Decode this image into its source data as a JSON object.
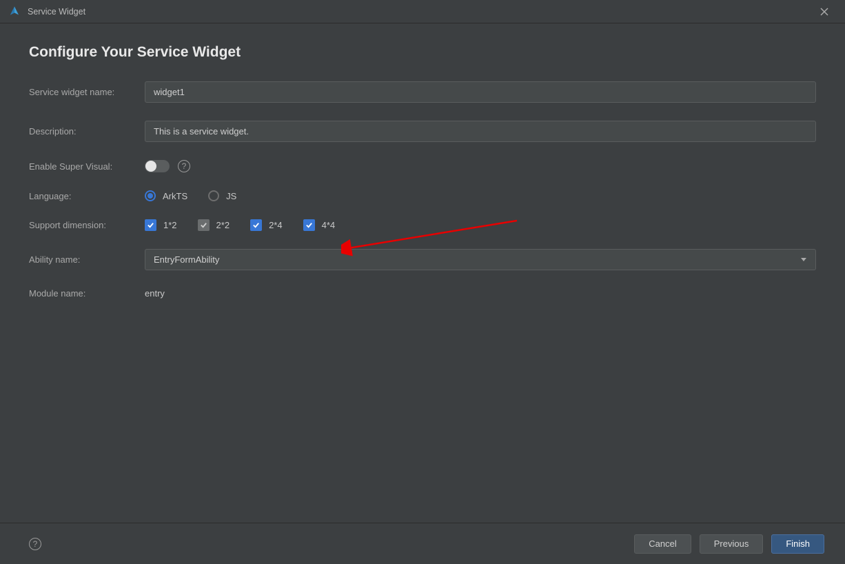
{
  "window": {
    "title": "Service Widget"
  },
  "page": {
    "heading": "Configure Your Service Widget"
  },
  "form": {
    "name_label": "Service widget name:",
    "name_value": "widget1",
    "desc_label": "Description:",
    "desc_value": "This is a service widget.",
    "super_visual_label": "Enable Super Visual:",
    "super_visual_on": false,
    "lang_label": "Language:",
    "lang_options": [
      {
        "label": "ArkTS",
        "selected": true
      },
      {
        "label": "JS",
        "selected": false
      }
    ],
    "dim_label": "Support dimension:",
    "dim_options": [
      {
        "label": "1*2",
        "checked": true,
        "locked": false
      },
      {
        "label": "2*2",
        "checked": true,
        "locked": true
      },
      {
        "label": "2*4",
        "checked": true,
        "locked": false
      },
      {
        "label": "4*4",
        "checked": true,
        "locked": false
      }
    ],
    "ability_label": "Ability name:",
    "ability_value": "EntryFormAbility",
    "module_label": "Module name:",
    "module_value": "entry"
  },
  "footer": {
    "cancel": "Cancel",
    "previous": "Previous",
    "finish": "Finish"
  },
  "help_glyph": "?"
}
